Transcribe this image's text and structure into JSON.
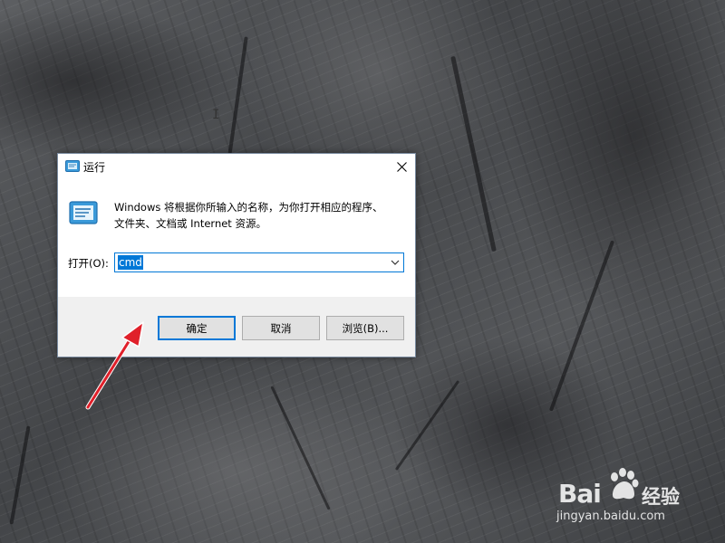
{
  "dialog": {
    "title": "运行",
    "description_line1": "Windows 将根据你所输入的名称，为你打开相应的程序、",
    "description_line2": "文件夹、文档或 Internet 资源。",
    "open_label": "打开(O):",
    "input_value": "cmd",
    "buttons": {
      "ok": "确定",
      "cancel": "取消",
      "browse": "浏览(B)..."
    }
  },
  "watermark": {
    "brand": "Bai",
    "brand_suffix": "经验",
    "url": "jingyan.baidu.com"
  },
  "colors": {
    "accent": "#0078d7",
    "arrow": "#e0202a"
  }
}
